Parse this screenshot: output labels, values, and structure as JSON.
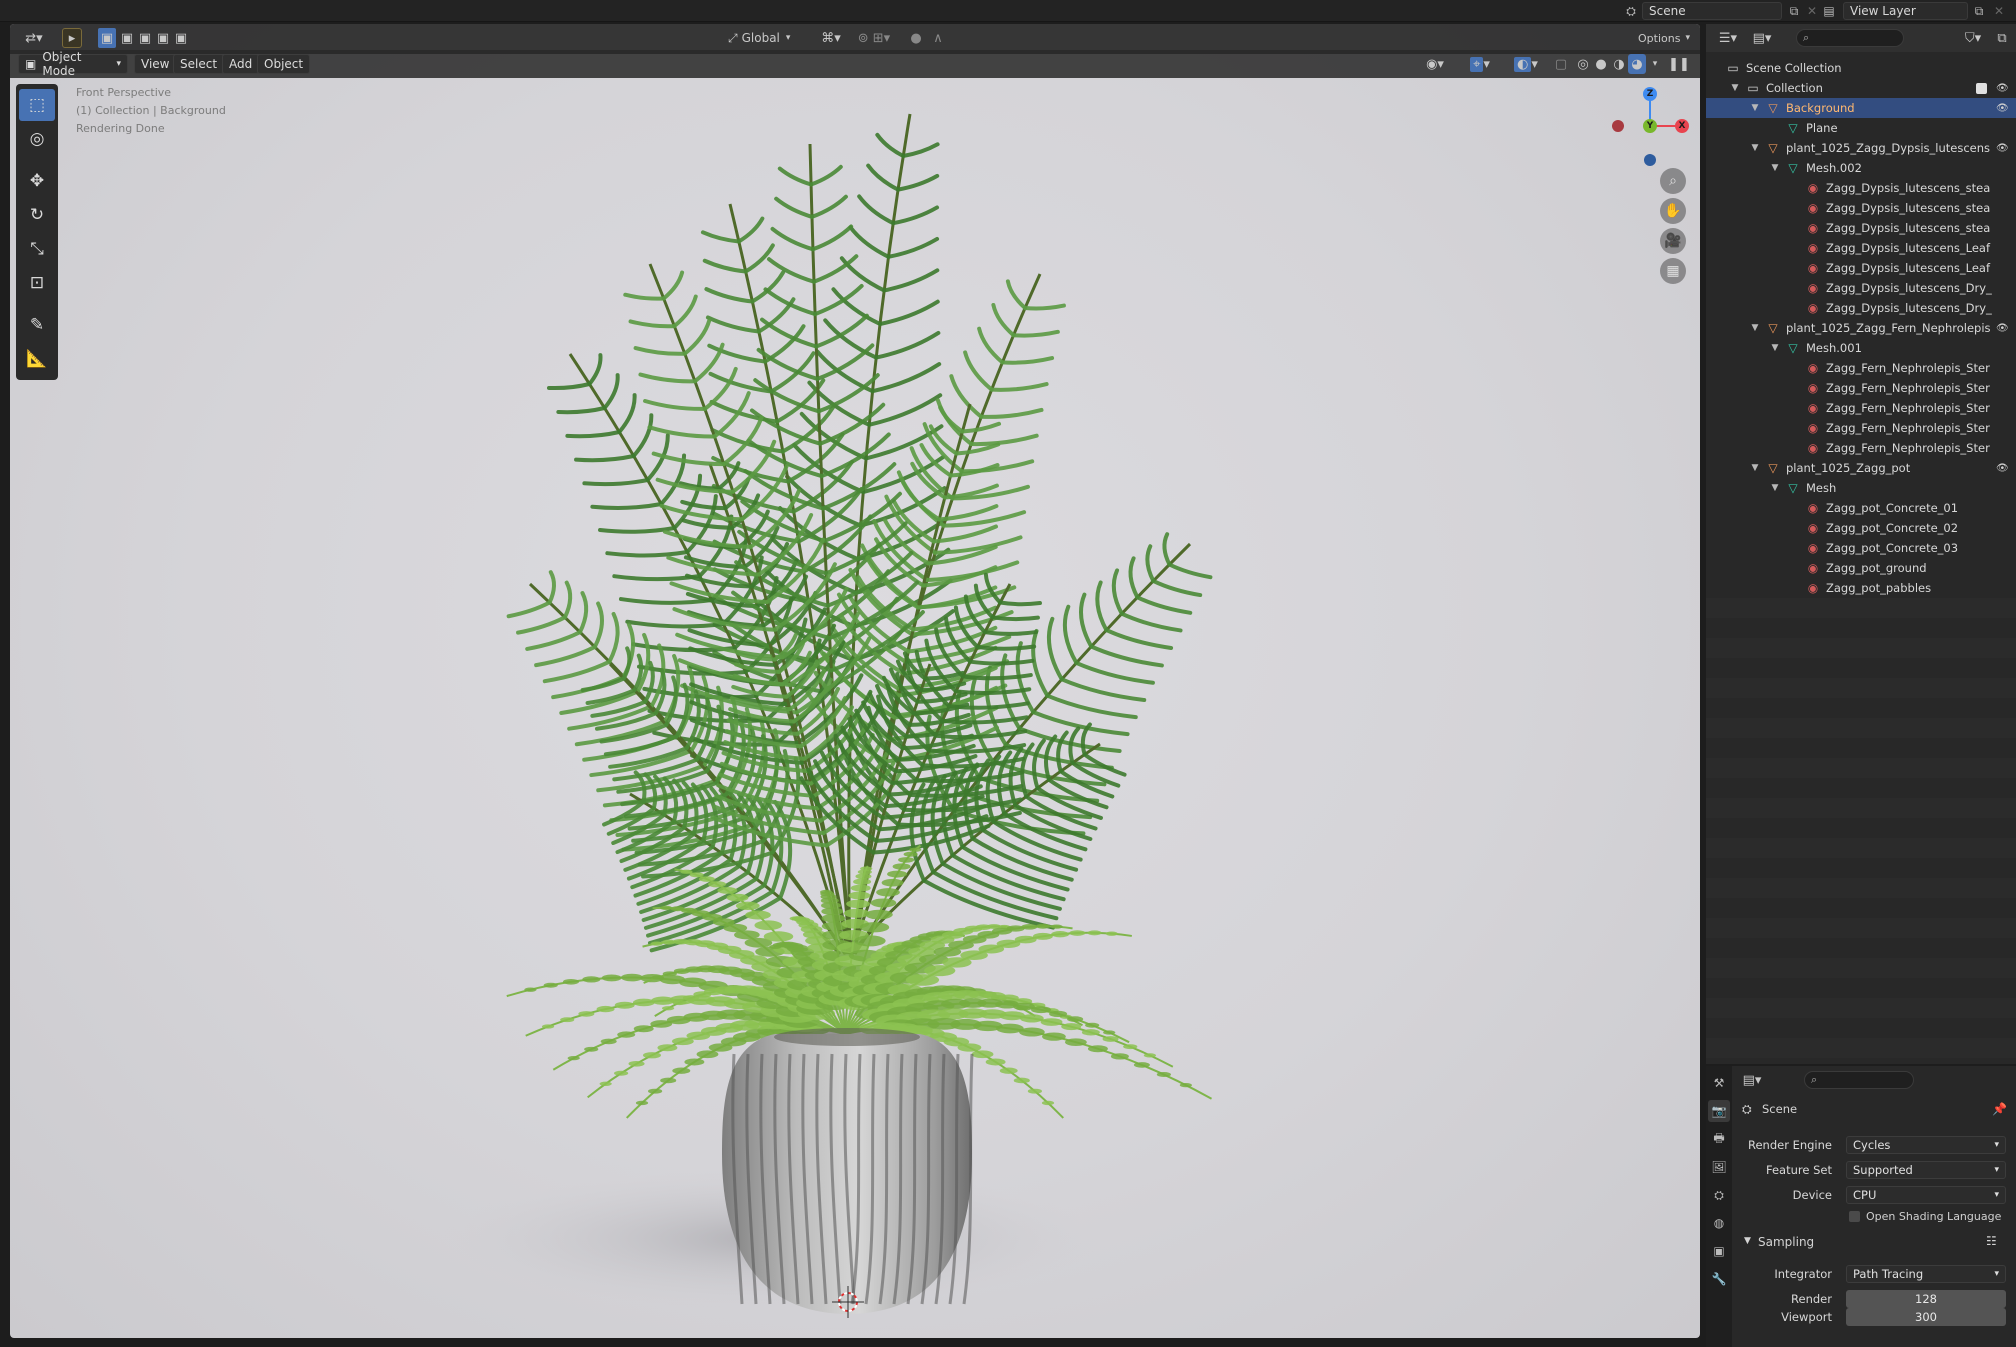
{
  "topbar": {
    "scene_name": "Scene",
    "view_layer": "View Layer"
  },
  "viewport": {
    "mode": "Object Mode",
    "menus": [
      "View",
      "Select",
      "Add",
      "Object"
    ],
    "transform_orientation": "Global",
    "options_label": "Options",
    "info": {
      "perspective": "Front Perspective",
      "collection": "(1) Collection | Background",
      "status": "Rendering Done"
    },
    "gizmo": {
      "x": "X",
      "y": "Y",
      "z": "Z"
    }
  },
  "outliner": {
    "rows": [
      {
        "label": "Scene Collection",
        "depth": 0,
        "icon": "scene-collection-icon",
        "expand": "",
        "selected": false,
        "eye": false
      },
      {
        "label": "Collection",
        "depth": 1,
        "icon": "collection-icon",
        "expand": "▼",
        "selected": false,
        "eye": true
      },
      {
        "label": "Background",
        "depth": 2,
        "icon": "object-icon",
        "expand": "▼",
        "selected": true,
        "eye": true
      },
      {
        "label": "Plane",
        "depth": 3,
        "icon": "mesh-icon",
        "expand": "",
        "selected": false,
        "eye": false
      },
      {
        "label": "plant_1025_Zagg_Dypsis_lutescens",
        "depth": 2,
        "icon": "object-icon",
        "expand": "▼",
        "selected": false,
        "eye": true
      },
      {
        "label": "Mesh.002",
        "depth": 3,
        "icon": "mesh-icon",
        "expand": "▼",
        "selected": false,
        "eye": false
      },
      {
        "label": "Zagg_Dypsis_lutescens_stea",
        "depth": 4,
        "icon": "material-icon",
        "expand": "",
        "selected": false,
        "eye": false
      },
      {
        "label": "Zagg_Dypsis_lutescens_stea",
        "depth": 4,
        "icon": "material-icon",
        "expand": "",
        "selected": false,
        "eye": false
      },
      {
        "label": "Zagg_Dypsis_lutescens_stea",
        "depth": 4,
        "icon": "material-icon",
        "expand": "",
        "selected": false,
        "eye": false
      },
      {
        "label": "Zagg_Dypsis_lutescens_Leaf",
        "depth": 4,
        "icon": "material-icon",
        "expand": "",
        "selected": false,
        "eye": false
      },
      {
        "label": "Zagg_Dypsis_lutescens_Leaf",
        "depth": 4,
        "icon": "material-icon",
        "expand": "",
        "selected": false,
        "eye": false
      },
      {
        "label": "Zagg_Dypsis_lutescens_Dry_",
        "depth": 4,
        "icon": "material-icon",
        "expand": "",
        "selected": false,
        "eye": false
      },
      {
        "label": "Zagg_Dypsis_lutescens_Dry_",
        "depth": 4,
        "icon": "material-icon",
        "expand": "",
        "selected": false,
        "eye": false
      },
      {
        "label": "plant_1025_Zagg_Fern_Nephrolepis",
        "depth": 2,
        "icon": "object-icon",
        "expand": "▼",
        "selected": false,
        "eye": true
      },
      {
        "label": "Mesh.001",
        "depth": 3,
        "icon": "mesh-icon",
        "expand": "▼",
        "selected": false,
        "eye": false
      },
      {
        "label": "Zagg_Fern_Nephrolepis_Ster",
        "depth": 4,
        "icon": "material-icon",
        "expand": "",
        "selected": false,
        "eye": false
      },
      {
        "label": "Zagg_Fern_Nephrolepis_Ster",
        "depth": 4,
        "icon": "material-icon",
        "expand": "",
        "selected": false,
        "eye": false
      },
      {
        "label": "Zagg_Fern_Nephrolepis_Ster",
        "depth": 4,
        "icon": "material-icon",
        "expand": "",
        "selected": false,
        "eye": false
      },
      {
        "label": "Zagg_Fern_Nephrolepis_Ster",
        "depth": 4,
        "icon": "material-icon",
        "expand": "",
        "selected": false,
        "eye": false
      },
      {
        "label": "Zagg_Fern_Nephrolepis_Ster",
        "depth": 4,
        "icon": "material-icon",
        "expand": "",
        "selected": false,
        "eye": false
      },
      {
        "label": "plant_1025_Zagg_pot",
        "depth": 2,
        "icon": "object-icon",
        "expand": "▼",
        "selected": false,
        "eye": true
      },
      {
        "label": "Mesh",
        "depth": 3,
        "icon": "mesh-icon",
        "expand": "▼",
        "selected": false,
        "eye": false
      },
      {
        "label": "Zagg_pot_Concrete_01",
        "depth": 4,
        "icon": "material-icon",
        "expand": "",
        "selected": false,
        "eye": false
      },
      {
        "label": "Zagg_pot_Concrete_02",
        "depth": 4,
        "icon": "material-icon",
        "expand": "",
        "selected": false,
        "eye": false
      },
      {
        "label": "Zagg_pot_Concrete_03",
        "depth": 4,
        "icon": "material-icon",
        "expand": "",
        "selected": false,
        "eye": false
      },
      {
        "label": "Zagg_pot_ground",
        "depth": 4,
        "icon": "material-icon",
        "expand": "",
        "selected": false,
        "eye": false
      },
      {
        "label": "Zagg_pot_pabbles",
        "depth": 4,
        "icon": "material-icon",
        "expand": "",
        "selected": false,
        "eye": false
      }
    ]
  },
  "properties": {
    "context": "Scene",
    "render_engine_label": "Render Engine",
    "render_engine": "Cycles",
    "feature_set_label": "Feature Set",
    "feature_set": "Supported",
    "device_label": "Device",
    "device": "CPU",
    "osl_label": "Open Shading Language",
    "sampling_label": "Sampling",
    "integrator_label": "Integrator",
    "integrator": "Path Tracing",
    "render_label": "Render",
    "render_samples": "128",
    "viewport_label": "Viewport",
    "viewport_samples": "300"
  },
  "colors": {
    "accent": "#4772b3",
    "selected_row": "#334d80",
    "object_icon": "#e8965a",
    "mesh_icon": "#35c2a3",
    "material_icon": "#d05a5a",
    "gizmo_x": "#e8444f",
    "gizmo_y": "#79b82c",
    "gizmo_z": "#3e8bf1"
  }
}
